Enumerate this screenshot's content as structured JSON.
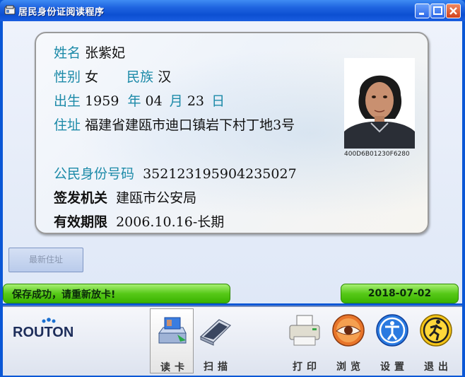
{
  "window": {
    "title": "居民身份证阅读程序"
  },
  "card": {
    "name_label": "姓名",
    "name": "张紫妃",
    "gender_label": "性别",
    "gender": "女",
    "ethnicity_label": "民族",
    "ethnicity": "汉",
    "birth_label": "出生",
    "birth_year": "1959",
    "year_label": "年",
    "birth_month": "04",
    "month_label": "月",
    "birth_day": "23",
    "day_label": "日",
    "address_label": "住址",
    "address": "福建省建瓯市迪口镇岩下村丁地3号",
    "id_label": "公民身份号码",
    "id_number": "352123195904235027",
    "authority_label": "签发机关",
    "authority": "建瓯市公安局",
    "validity_label": "有效期限",
    "validity": "2006.10.16-长期",
    "photo_code": "400D6B01230F6280"
  },
  "buttons": {
    "latest_address": "最新住址"
  },
  "status": {
    "message": "保存成功，请重新放卡!",
    "date": "2018-07-02"
  },
  "brand": {
    "logo_text": "ROUTON"
  },
  "toolbar": {
    "read": "读卡",
    "scan": "扫描",
    "print": "打印",
    "browse": "浏览",
    "settings": "设置",
    "exit": "退出"
  }
}
